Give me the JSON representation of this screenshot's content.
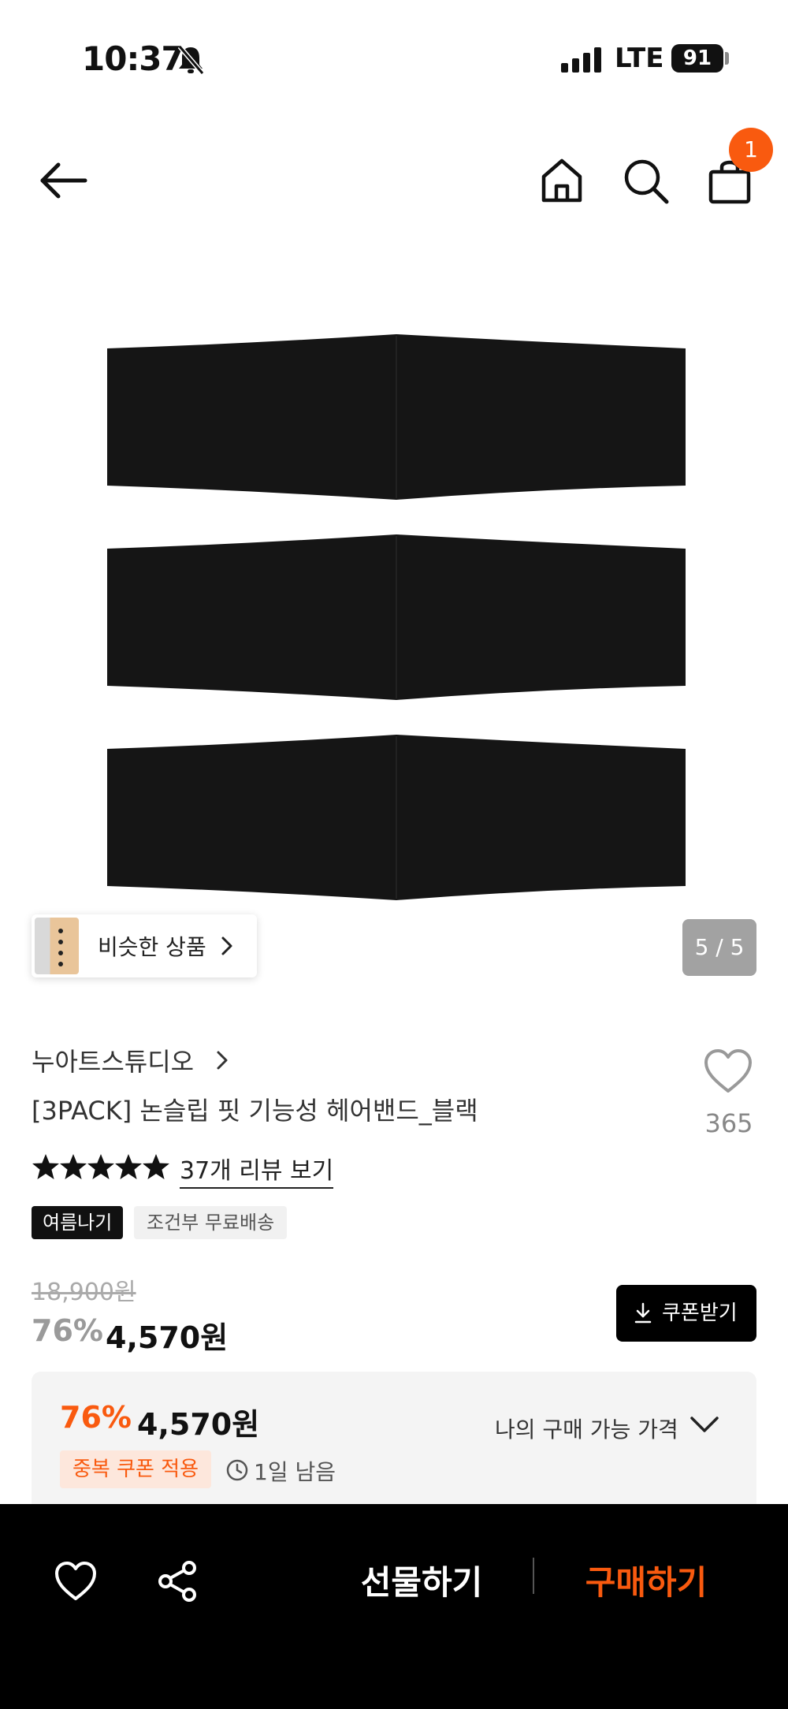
{
  "status_bar": {
    "time": "10:37",
    "network": "LTE",
    "battery": "91",
    "icons": [
      "bell-off-icon",
      "signal-icon",
      "battery-icon"
    ]
  },
  "nav": {
    "icons": [
      "back-arrow-icon",
      "home-icon",
      "search-icon",
      "shopping-bag-icon"
    ],
    "cart_count": "1"
  },
  "gallery": {
    "similar_label": "비슷한 상품",
    "counter": "5 / 5"
  },
  "product": {
    "brand": "누아트스튜디오",
    "title": "[3PACK] 논슬립 핏 기능성 헤어밴드_블랙",
    "like_count": "365",
    "rating_stars": 5,
    "review_link": "37개 리뷰 보기",
    "tags": [
      "여름나기",
      "조건부 무료배송"
    ],
    "original_price": "18,900원",
    "discount_rate": "76%",
    "sale_price": "4,570원",
    "coupon_button": "쿠폰받기"
  },
  "benefit": {
    "rate": "76%",
    "price": "4,570원",
    "label": "나의 구매 가능 가격",
    "coupon_tag": "중복 쿠폰 적용",
    "time_left": "1일 남음"
  },
  "bottom_bar": {
    "gift_label": "선물하기",
    "buy_label": "구매하기"
  },
  "colors": {
    "accent": "#f95a0f",
    "dark": "#000000"
  }
}
